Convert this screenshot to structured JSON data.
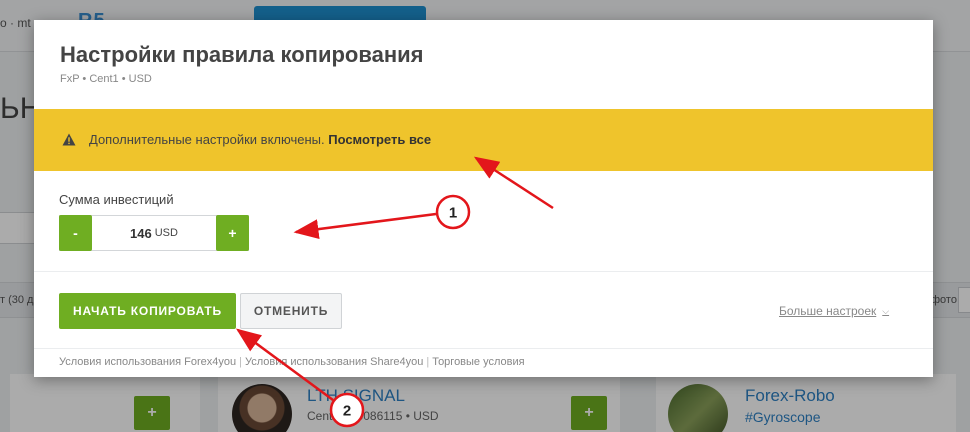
{
  "background": {
    "site_fragment": "o · mt",
    "logo_fragment": "R5",
    "page_title_fragment": "ЬН",
    "filter_left_fragment": "т (30 д",
    "filter_right_fragment": "фото",
    "traders": [
      {
        "name": "LTH SIGNAL",
        "meta": "Cent1 • 30086115 • USD"
      },
      {
        "name": "Forex-Robo",
        "tag": "#Gyroscope"
      }
    ],
    "plus_label": "+"
  },
  "modal": {
    "title": "Настройки правила копирования",
    "subtitle": "FxP • Cent1 • USD",
    "notice": {
      "icon": "warning-icon",
      "text": "Дополнительные настройки включены.",
      "link": "Посмотреть все",
      "color": "#efc42c"
    },
    "investment": {
      "label": "Сумма инвестиций",
      "minus": "-",
      "plus": "+",
      "amount": "146",
      "currency": "USD"
    },
    "buttons": {
      "start": "НАЧАТЬ КОПИРОВАТЬ",
      "cancel": "ОТМЕНИТЬ",
      "more_settings": "Больше настроек",
      "more_settings_icon": "chevron-down-icon"
    },
    "footer_links": [
      "Условия использования Forex4you",
      "Условия использования Share4you",
      "Торговые условия"
    ],
    "accent_color": "#6fae22"
  },
  "annotations": {
    "badges": [
      "1",
      "2"
    ],
    "arrow_color": "#e3161b"
  }
}
